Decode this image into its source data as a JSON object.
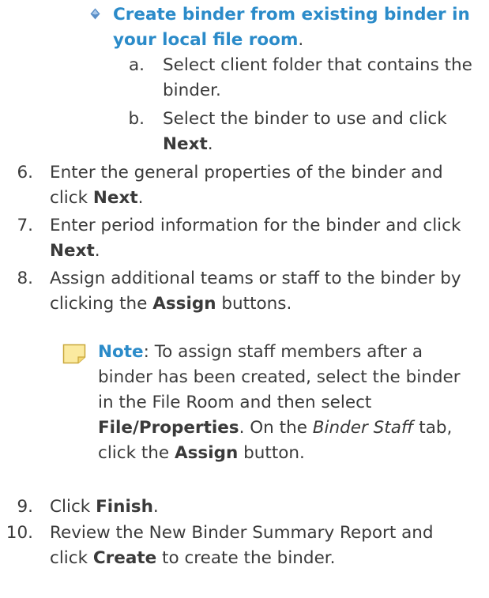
{
  "bullet": {
    "title": "Create binder from existing binder in your local file room",
    "title_suffix": ".",
    "icon": "diamond-bullet-icon",
    "color": "#2b8bc9",
    "sub_items": [
      {
        "marker": "a.",
        "text": "Select client folder that contains the binder."
      },
      {
        "marker": "b.",
        "text_before": "Select the binder to use and click ",
        "bold": "Next",
        "text_after": "."
      }
    ]
  },
  "steps": [
    {
      "num": "6.",
      "text_before": "Enter the general properties of the binder and click ",
      "bold": "Next",
      "text_after": "."
    },
    {
      "num": "7.",
      "text_before": "Enter period information for the binder and click ",
      "bold": "Next",
      "text_after": "."
    },
    {
      "num": "8.",
      "text_before": "Assign additional teams or staff to the binder by clicking the ",
      "bold": "Assign",
      "text_after": " buttons."
    },
    {
      "num": "9.",
      "text_before": "Click ",
      "bold": "Finish",
      "text_after": "."
    },
    {
      "num": "10.",
      "text_before": "Review the New Binder Summary Report and click ",
      "bold": "Create",
      "text_after": " to create the binder."
    }
  ],
  "note": {
    "icon": "sticky-note-icon",
    "label": "Note",
    "text_1": ": To assign staff members after a binder has been created, select the binder in the File Room and then select ",
    "bold_1": "File/Properties",
    "text_2": ". On the ",
    "italic_1": "Binder Staff",
    "text_3": " tab, click the ",
    "bold_2": "Assign",
    "text_4": " button."
  }
}
